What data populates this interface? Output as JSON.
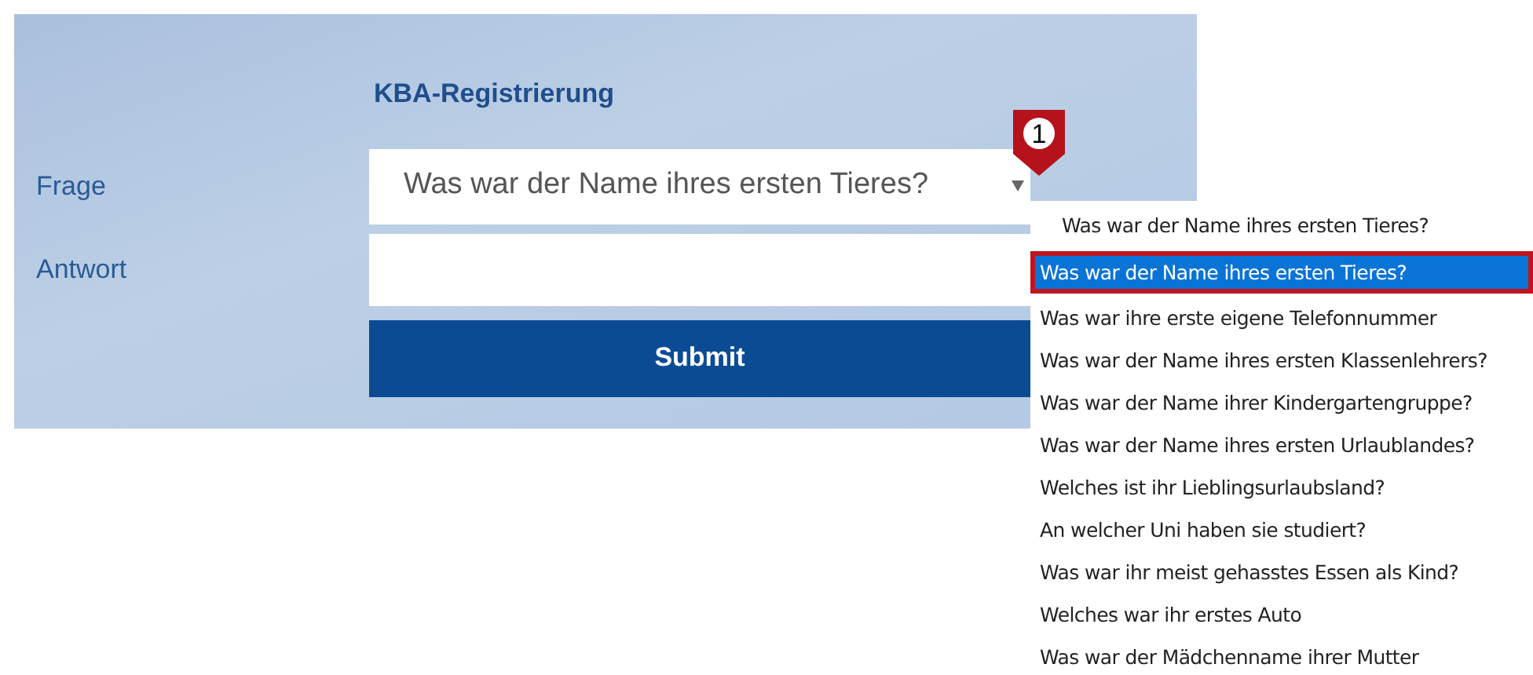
{
  "form": {
    "title": "KBA-Registrierung",
    "question": {
      "label": "Frage",
      "value": "Was war der Name ihres ersten Tieres?",
      "marker": "1"
    },
    "answer": {
      "label": "Antwort"
    },
    "submit": "Submit"
  },
  "dropdown": {
    "current": "Was war der Name ihres ersten Tieres?",
    "options": [
      {
        "text": "Was war der Name ihres ersten Tieres?",
        "selected": true
      },
      {
        "text": "Was war ihre erste eigene Telefonnummer",
        "selected": false
      },
      {
        "text": "Was war der Name ihres ersten Klassenlehrers?",
        "selected": false
      },
      {
        "text": "Was war der Name ihrer Kindergartengruppe?",
        "selected": false
      },
      {
        "text": "Was war der Name ihres ersten Urlaublandes?",
        "selected": false
      },
      {
        "text": "Welches ist ihr Lieblingsurlaubsland?",
        "selected": false
      },
      {
        "text": "An welcher Uni haben sie studiert?",
        "selected": false
      },
      {
        "text": "Was war ihr meist gehasstes Essen als Kind?",
        "selected": false
      },
      {
        "text": "Welches war ihr erstes Auto",
        "selected": false
      },
      {
        "text": "Was war der Mädchenname ihrer Mutter",
        "selected": false
      }
    ]
  }
}
